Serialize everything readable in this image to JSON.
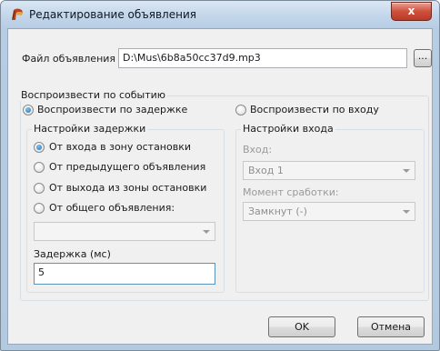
{
  "window": {
    "title": "Редактирование объявления",
    "close_label": "x"
  },
  "file": {
    "label": "Файл объявления",
    "value": "D:\\Mus\\6b8a50cc37d9.mp3",
    "browse_label": "..."
  },
  "event_group": {
    "title": "Воспроизвести по событию",
    "option_delay": "Воспроизвести по задержке",
    "option_input": "Воспроизвести по входу"
  },
  "delay_settings": {
    "title": "Настройки задержки",
    "options": [
      "От входа в зону остановки",
      "От предыдущего объявления",
      "От выхода из зоны остановки",
      "От общего объявления:"
    ],
    "common_select_value": "",
    "delay_label": "Задержка (мс)",
    "delay_value": "5"
  },
  "input_settings": {
    "title": "Настройки входа",
    "input_label": "Вход:",
    "input_value": "Вход 1",
    "trigger_label": "Момент сработки:",
    "trigger_value": "Замкнут (-)"
  },
  "buttons": {
    "ok": "OK",
    "cancel": "Отмена"
  }
}
